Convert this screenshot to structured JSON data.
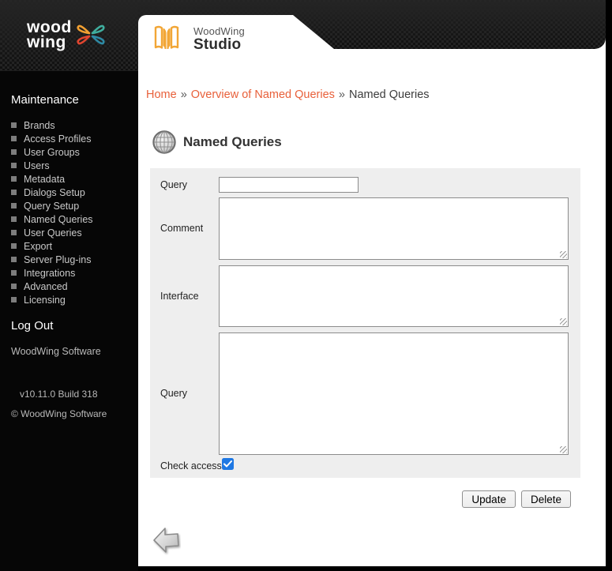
{
  "sidebar": {
    "logo": {
      "line1": "wood",
      "line2": "wing"
    },
    "menu_title": "Maintenance",
    "menu_items": [
      "Brands",
      "Access Profiles",
      "User Groups",
      "Users",
      "Metadata",
      "Dialogs Setup",
      "Query Setup",
      "Named Queries",
      "User Queries",
      "Export",
      "Server Plug-ins",
      "Integrations",
      "Advanced",
      "Licensing"
    ],
    "logout_label": "Log Out",
    "company": "WoodWing Software",
    "version": "v10.11.0 Build 318",
    "copyright": "© WoodWing Software"
  },
  "header": {
    "brand": "WoodWing",
    "product": "Studio"
  },
  "breadcrumb": {
    "separator": "»",
    "items": [
      {
        "label": "Home",
        "type": "link"
      },
      {
        "label": "Overview of Named Queries",
        "type": "link"
      },
      {
        "label": "Named Queries",
        "type": "current"
      }
    ]
  },
  "page": {
    "title": "Named Queries"
  },
  "form": {
    "fields": [
      {
        "label": "Query",
        "type": "text",
        "value": ""
      },
      {
        "label": "Comment",
        "type": "textarea",
        "value": ""
      },
      {
        "label": "Interface",
        "type": "textarea",
        "value": ""
      },
      {
        "label": "Query",
        "type": "textarea",
        "value": ""
      },
      {
        "label": "Check access",
        "type": "checkbox",
        "checked": true
      }
    ],
    "buttons": [
      {
        "label": "Update"
      },
      {
        "label": "Delete"
      }
    ]
  },
  "colors": {
    "link_orange": "#e8603a",
    "studio_orange": "#f2a636",
    "checkbox_blue": "#1e78e3",
    "panel_gray": "#eeeeee"
  }
}
